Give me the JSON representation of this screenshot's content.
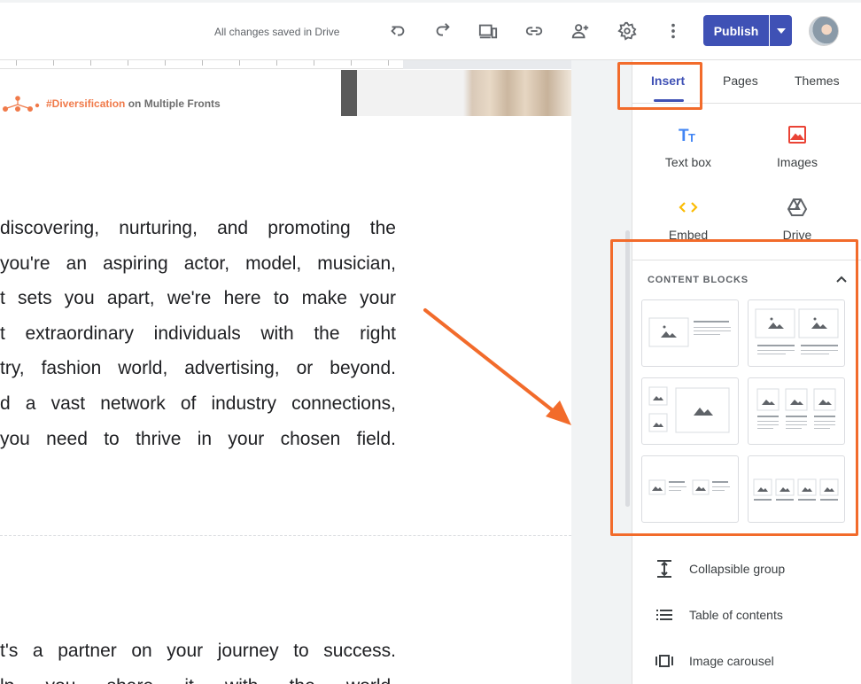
{
  "toolbar": {
    "save_status": "All changes saved in Drive",
    "publish_label": "Publish",
    "icons": [
      "undo-icon",
      "redo-icon",
      "preview-icon",
      "link-icon",
      "share-icon",
      "settings-icon",
      "more-icon",
      "dropdown-icon"
    ]
  },
  "header_strip": {
    "title_highlight": "#Diversification",
    "title_rest": " on Multiple Fronts"
  },
  "page": {
    "para1": [
      "discovering, nurturing, and promoting the",
      "you're an aspiring actor, model, musician,",
      "t sets you apart, we're here to make your",
      "t extraordinary individuals with the right",
      "try, fashion world, advertising, or beyond.",
      "d a vast network of industry connections,",
      "you need to thrive in your chosen field."
    ],
    "para2": [
      "t's a partner on your journey to success.",
      "lp you share it with the world."
    ]
  },
  "sidebar": {
    "tabs": [
      {
        "label": "Insert",
        "active": true
      },
      {
        "label": "Pages",
        "active": false
      },
      {
        "label": "Themes",
        "active": false
      }
    ],
    "insert_items": [
      {
        "label": "Text box",
        "icon": "text-box-icon"
      },
      {
        "label": "Images",
        "icon": "image-icon"
      },
      {
        "label": "Embed",
        "icon": "embed-icon"
      },
      {
        "label": "Drive",
        "icon": "drive-icon"
      }
    ],
    "content_blocks_title": "CONTENT BLOCKS",
    "list_items": [
      {
        "label": "Collapsible group",
        "icon": "collapsible-group-icon"
      },
      {
        "label": "Table of contents",
        "icon": "table-of-contents-icon"
      },
      {
        "label": "Image carousel",
        "icon": "image-carousel-icon"
      }
    ]
  },
  "colors": {
    "accent": "#3f51b5",
    "annotation": "#f26b2b",
    "images_icon": "#ea4335",
    "embed_icon": "#fbbc04",
    "textbox_icon": "#4285f4"
  }
}
